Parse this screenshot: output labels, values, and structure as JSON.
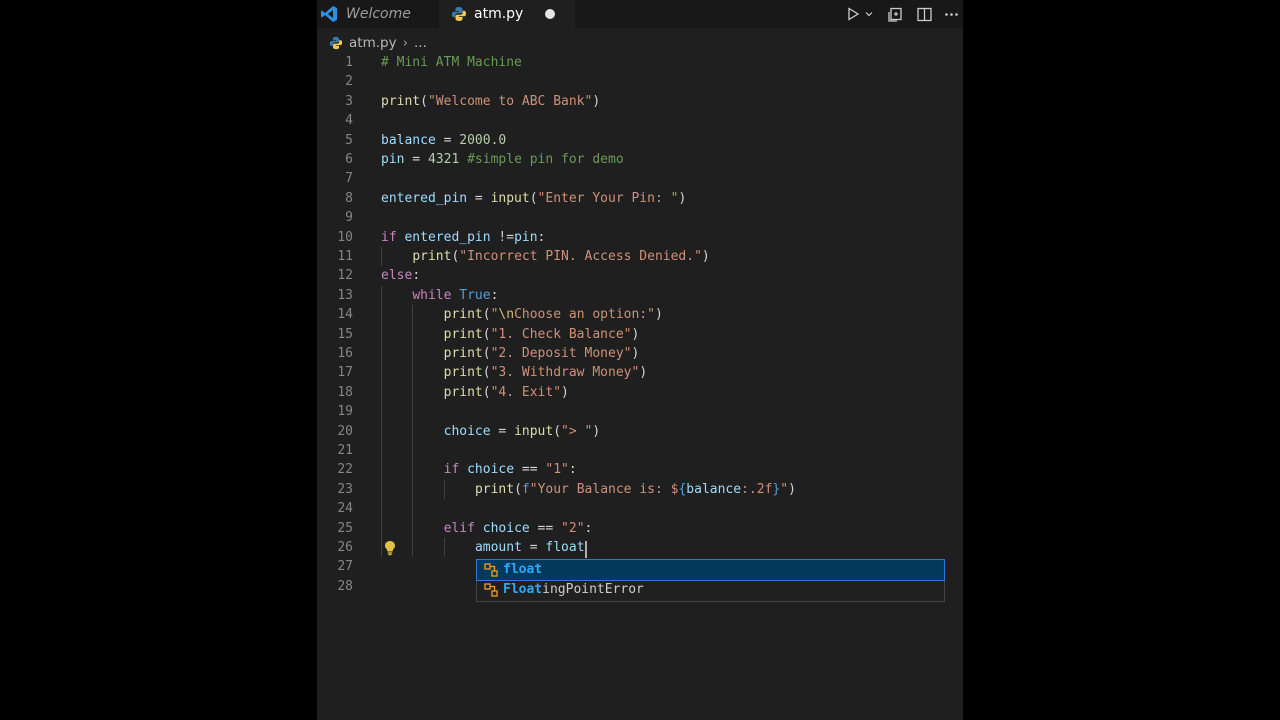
{
  "tabs": [
    {
      "label": "Welcome",
      "active": false
    },
    {
      "label": "atm.py",
      "active": true,
      "modified": true
    }
  ],
  "toolbar": {
    "icons": [
      "run-icon",
      "chevron-down-icon",
      "open-changes-icon",
      "split-editor-icon",
      "more-icon"
    ]
  },
  "breadcrumb": {
    "file": "atm.py",
    "ellipsis": "..."
  },
  "editor": {
    "lines": [
      {
        "n": "1",
        "indent": 0,
        "tokens": [
          [
            "# Mini ATM Machine",
            "cm"
          ]
        ]
      },
      {
        "n": "2",
        "indent": 0,
        "tokens": []
      },
      {
        "n": "3",
        "indent": 0,
        "tokens": [
          [
            "print",
            "fn"
          ],
          [
            "(",
            "op"
          ],
          [
            "\"Welcome to ABC Bank\"",
            "str"
          ],
          [
            ")",
            "op"
          ]
        ]
      },
      {
        "n": "4",
        "indent": 0,
        "tokens": []
      },
      {
        "n": "5",
        "indent": 0,
        "tokens": [
          [
            "balance",
            "var"
          ],
          [
            " = ",
            "op"
          ],
          [
            "2000.0",
            "num"
          ]
        ]
      },
      {
        "n": "6",
        "indent": 0,
        "tokens": [
          [
            "pin",
            "var"
          ],
          [
            " = ",
            "op"
          ],
          [
            "4321",
            "num"
          ],
          [
            " #simple pin for demo",
            "cm"
          ]
        ]
      },
      {
        "n": "7",
        "indent": 0,
        "tokens": []
      },
      {
        "n": "8",
        "indent": 0,
        "tokens": [
          [
            "entered_pin",
            "var"
          ],
          [
            " = ",
            "op"
          ],
          [
            "input",
            "fn"
          ],
          [
            "(",
            "op"
          ],
          [
            "\"Enter Your Pin: \"",
            "str"
          ],
          [
            ")",
            "op"
          ]
        ]
      },
      {
        "n": "9",
        "indent": 0,
        "tokens": []
      },
      {
        "n": "10",
        "indent": 0,
        "tokens": [
          [
            "if",
            "kw"
          ],
          [
            " ",
            "op"
          ],
          [
            "entered_pin",
            "var"
          ],
          [
            " !=",
            "op"
          ],
          [
            "pin",
            "var"
          ],
          [
            ":",
            "op"
          ]
        ]
      },
      {
        "n": "11",
        "indent": 1,
        "tokens": [
          [
            "print",
            "fn"
          ],
          [
            "(",
            "op"
          ],
          [
            "\"Incorrect PIN. Access Denied.\"",
            "str"
          ],
          [
            ")",
            "op"
          ]
        ]
      },
      {
        "n": "12",
        "indent": 0,
        "tokens": [
          [
            "else",
            "kw"
          ],
          [
            ":",
            "op"
          ]
        ]
      },
      {
        "n": "13",
        "indent": 1,
        "tokens": [
          [
            "while",
            "kw"
          ],
          [
            " ",
            "op"
          ],
          [
            "True",
            "kw2"
          ],
          [
            ":",
            "op"
          ]
        ]
      },
      {
        "n": "14",
        "indent": 2,
        "tokens": [
          [
            "print",
            "fn"
          ],
          [
            "(",
            "op"
          ],
          [
            "\"",
            "str"
          ],
          [
            "\\n",
            "esc"
          ],
          [
            "Choose an option:\"",
            "str"
          ],
          [
            ")",
            "op"
          ]
        ]
      },
      {
        "n": "15",
        "indent": 2,
        "tokens": [
          [
            "print",
            "fn"
          ],
          [
            "(",
            "op"
          ],
          [
            "\"1. Check Balance\"",
            "str"
          ],
          [
            ")",
            "op"
          ]
        ]
      },
      {
        "n": "16",
        "indent": 2,
        "tokens": [
          [
            "print",
            "fn"
          ],
          [
            "(",
            "op"
          ],
          [
            "\"2. Deposit Money\"",
            "str"
          ],
          [
            ")",
            "op"
          ]
        ]
      },
      {
        "n": "17",
        "indent": 2,
        "tokens": [
          [
            "print",
            "fn"
          ],
          [
            "(",
            "op"
          ],
          [
            "\"3. Withdraw Money\"",
            "str"
          ],
          [
            ")",
            "op"
          ]
        ]
      },
      {
        "n": "18",
        "indent": 2,
        "tokens": [
          [
            "print",
            "fn"
          ],
          [
            "(",
            "op"
          ],
          [
            "\"4. Exit\"",
            "str"
          ],
          [
            ")",
            "op"
          ]
        ]
      },
      {
        "n": "19",
        "indent": 2,
        "tokens": []
      },
      {
        "n": "20",
        "indent": 2,
        "tokens": [
          [
            "choice",
            "var"
          ],
          [
            " = ",
            "op"
          ],
          [
            "input",
            "fn"
          ],
          [
            "(",
            "op"
          ],
          [
            "\"> \"",
            "str"
          ],
          [
            ")",
            "op"
          ]
        ]
      },
      {
        "n": "21",
        "indent": 2,
        "tokens": []
      },
      {
        "n": "22",
        "indent": 2,
        "tokens": [
          [
            "if",
            "kw"
          ],
          [
            " ",
            "op"
          ],
          [
            "choice",
            "var"
          ],
          [
            " == ",
            "op"
          ],
          [
            "\"1\"",
            "str"
          ],
          [
            ":",
            "op"
          ]
        ]
      },
      {
        "n": "23",
        "indent": 3,
        "tokens": [
          [
            "print",
            "fn"
          ],
          [
            "(",
            "op"
          ],
          [
            "f",
            "fstr"
          ],
          [
            "\"Your Balance is: $",
            "str"
          ],
          [
            "{",
            "brace"
          ],
          [
            "balance",
            "var"
          ],
          [
            ":.2f",
            "str"
          ],
          [
            "}",
            "brace"
          ],
          [
            "\"",
            "str"
          ],
          [
            ")",
            "op"
          ]
        ]
      },
      {
        "n": "24",
        "indent": 2,
        "tokens": []
      },
      {
        "n": "25",
        "indent": 2,
        "tokens": [
          [
            "elif",
            "kw"
          ],
          [
            " ",
            "op"
          ],
          [
            "choice",
            "var"
          ],
          [
            " == ",
            "op"
          ],
          [
            "\"2\"",
            "str"
          ],
          [
            ":",
            "op"
          ]
        ]
      },
      {
        "n": "26",
        "indent": 3,
        "tokens": [
          [
            "amount",
            "var"
          ],
          [
            " = ",
            "op"
          ],
          [
            "float",
            "var"
          ]
        ]
      },
      {
        "n": "27",
        "indent": 0,
        "tokens": []
      },
      {
        "n": "28",
        "indent": 0,
        "tokens": []
      }
    ]
  },
  "suggestions": [
    {
      "match": "float",
      "rest": "",
      "selected": true
    },
    {
      "match": "Float",
      "rest": "ingPointError",
      "selected": false
    }
  ]
}
